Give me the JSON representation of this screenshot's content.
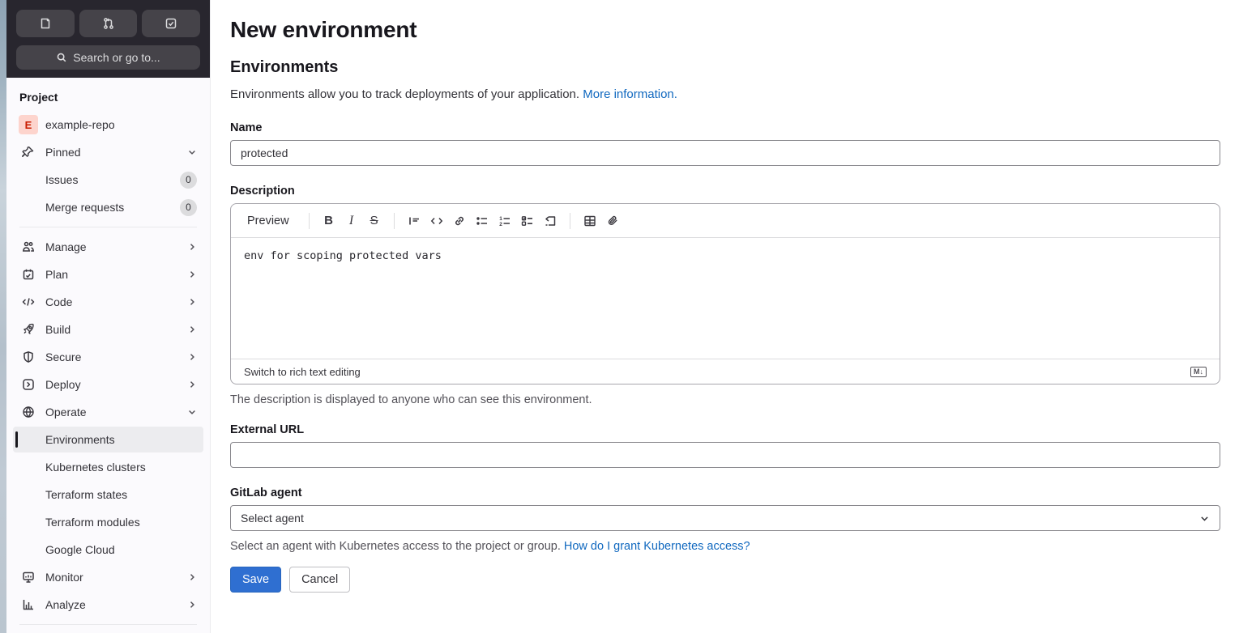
{
  "colors": {
    "link": "#1068bf",
    "save_button": "#2f6fd1",
    "sidebar_bg": "#fbfafd",
    "topbar_bg": "#28262e",
    "topbar_button_bg": "#454349",
    "active_item_bg": "#ececef",
    "avatar_bg": "#fdd4cd",
    "avatar_fg": "#c91c00"
  },
  "topbar": {
    "buttons": [
      {
        "icon": "issues-icon"
      },
      {
        "icon": "merge-request-icon"
      },
      {
        "icon": "todo-icon"
      }
    ],
    "search": {
      "icon": "search-icon",
      "label": "Search or go to..."
    }
  },
  "sidebar": {
    "section_label": "Project",
    "project": {
      "avatar_letter": "E",
      "name": "example-repo"
    },
    "pinned": {
      "label": "Pinned",
      "icon": "pin-icon"
    },
    "pinned_items": [
      {
        "label": "Issues",
        "count": "0"
      },
      {
        "label": "Merge requests",
        "count": "0"
      }
    ],
    "nav": [
      {
        "label": "Manage",
        "icon": "users-icon"
      },
      {
        "label": "Plan",
        "icon": "calendar-icon"
      },
      {
        "label": "Code",
        "icon": "code-icon"
      },
      {
        "label": "Build",
        "icon": "rocket-icon"
      },
      {
        "label": "Secure",
        "icon": "shield-icon"
      },
      {
        "label": "Deploy",
        "icon": "deploy-icon"
      },
      {
        "label": "Operate",
        "icon": "operate-icon"
      }
    ],
    "operate_children": [
      {
        "label": "Environments",
        "active": true
      },
      {
        "label": "Kubernetes clusters"
      },
      {
        "label": "Terraform states"
      },
      {
        "label": "Terraform modules"
      },
      {
        "label": "Google Cloud"
      }
    ],
    "bottom_nav": [
      {
        "label": "Monitor",
        "icon": "monitor-icon"
      },
      {
        "label": "Analyze",
        "icon": "analyze-icon"
      }
    ]
  },
  "main": {
    "title": "New environment",
    "heading": "Environments",
    "intro_text": "Environments allow you to track deployments of your application.",
    "intro_link": "More information.",
    "name": {
      "label": "Name",
      "value": "protected"
    },
    "description": {
      "label": "Description",
      "preview_tab": "Preview",
      "toolbar": {
        "bold": "B",
        "italic": "I",
        "strike": "S"
      },
      "content": "env for scoping protected vars",
      "switch_link": "Switch to rich text editing",
      "markdown_badge": "M↓",
      "help": "The description is displayed to anyone who can see this environment."
    },
    "external_url": {
      "label": "External URL",
      "value": ""
    },
    "agent": {
      "label": "GitLab agent",
      "value": "Select agent",
      "help": "Select an agent with Kubernetes access to the project or group.",
      "help_link": "How do I grant Kubernetes access?"
    },
    "actions": {
      "save": "Save",
      "cancel": "Cancel"
    }
  }
}
